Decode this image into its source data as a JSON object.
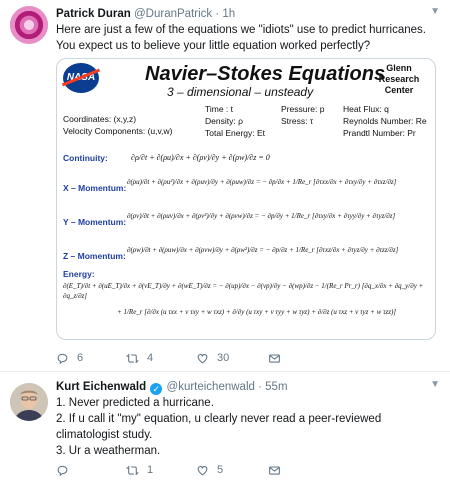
{
  "tweet1": {
    "name": "Patrick Duran",
    "handle": "@DuranPatrick",
    "separator": "·",
    "time": "1h",
    "text": "Here are just a few of the equations we \"idiots\" use to predict hurricanes. You expect us to believe your little equation worked perfectly?",
    "image": {
      "logo": "NASA",
      "title": "Navier–Stokes Equations",
      "subtitle": "3 – dimensional – unsteady",
      "center_line1": "Glenn",
      "center_line2": "Research",
      "center_line3": "Center",
      "def_coords": "Coordinates: (x,y,z)",
      "def_velocity": "Velocity Components: (u,v,w)",
      "def_time": "Time : t",
      "def_density": "Density: ρ",
      "def_energy": "Total Energy: Et",
      "def_pressure": "Pressure: p",
      "def_stress": "Stress: τ",
      "def_heat": "Heat Flux: q",
      "def_reynolds": "Reynolds Number: Re",
      "def_prandtl": "Prandtl Number: Pr",
      "label_continuity": "Continuity:",
      "label_x": "X – Momentum:",
      "label_y": "Y – Momentum:",
      "label_z": "Z – Momentum:",
      "label_energy": "Energy:",
      "eq_continuity": "∂ρ/∂t + ∂(ρu)/∂x + ∂(ρv)/∂y + ∂(ρw)/∂z = 0",
      "eq_x": "∂(ρu)/∂t + ∂(ρu²)/∂x + ∂(ρuv)/∂y + ∂(ρuw)/∂z = − ∂p/∂x + 1/Re_r [∂τxx/∂x + ∂τxy/∂y + ∂τxz/∂z]",
      "eq_y": "∂(ρv)/∂t + ∂(ρuv)/∂x + ∂(ρv²)/∂y + ∂(ρvw)/∂z = − ∂p/∂y + 1/Re_r [∂τxy/∂x + ∂τyy/∂y + ∂τyz/∂z]",
      "eq_z": "∂(ρw)/∂t + ∂(ρuw)/∂x + ∂(ρvw)/∂y + ∂(ρw²)/∂z = − ∂p/∂z + 1/Re_r [∂τxz/∂x + ∂τyz/∂y + ∂τzz/∂z]",
      "eq_energy1": "∂(E_T)/∂t + ∂(uE_T)/∂x + ∂(vE_T)/∂y + ∂(wE_T)/∂z = − ∂(up)/∂x − ∂(vp)/∂y − ∂(wp)/∂z − 1/(Re_r Pr_r) [∂q_x/∂x + ∂q_y/∂y + ∂q_z/∂z]",
      "eq_energy2": "+ 1/Re_r [∂/∂x (u τxx + v τxy + w τxz) + ∂/∂y (u τxy + v τyy + w τyz) + ∂/∂z (u τxz + v τyz + w τzz)]"
    },
    "replies": "6",
    "retweets": "4",
    "likes": "30"
  },
  "tweet2": {
    "name": "Kurt Eichenwald",
    "handle": "@kurteichenwald",
    "separator": "·",
    "time": "55m",
    "line1": "1. Never predicted a hurricane.",
    "line2": "2. If u call it \"my\" equation, u clearly never read a peer-reviewed climatologist study.",
    "line3": "3. Ur a weatherman.",
    "replies": "",
    "retweets": "1",
    "likes": "5"
  },
  "colors": {
    "link": "#1da1f2",
    "muted": "#657786",
    "label_blue": "#1f3fa0"
  }
}
